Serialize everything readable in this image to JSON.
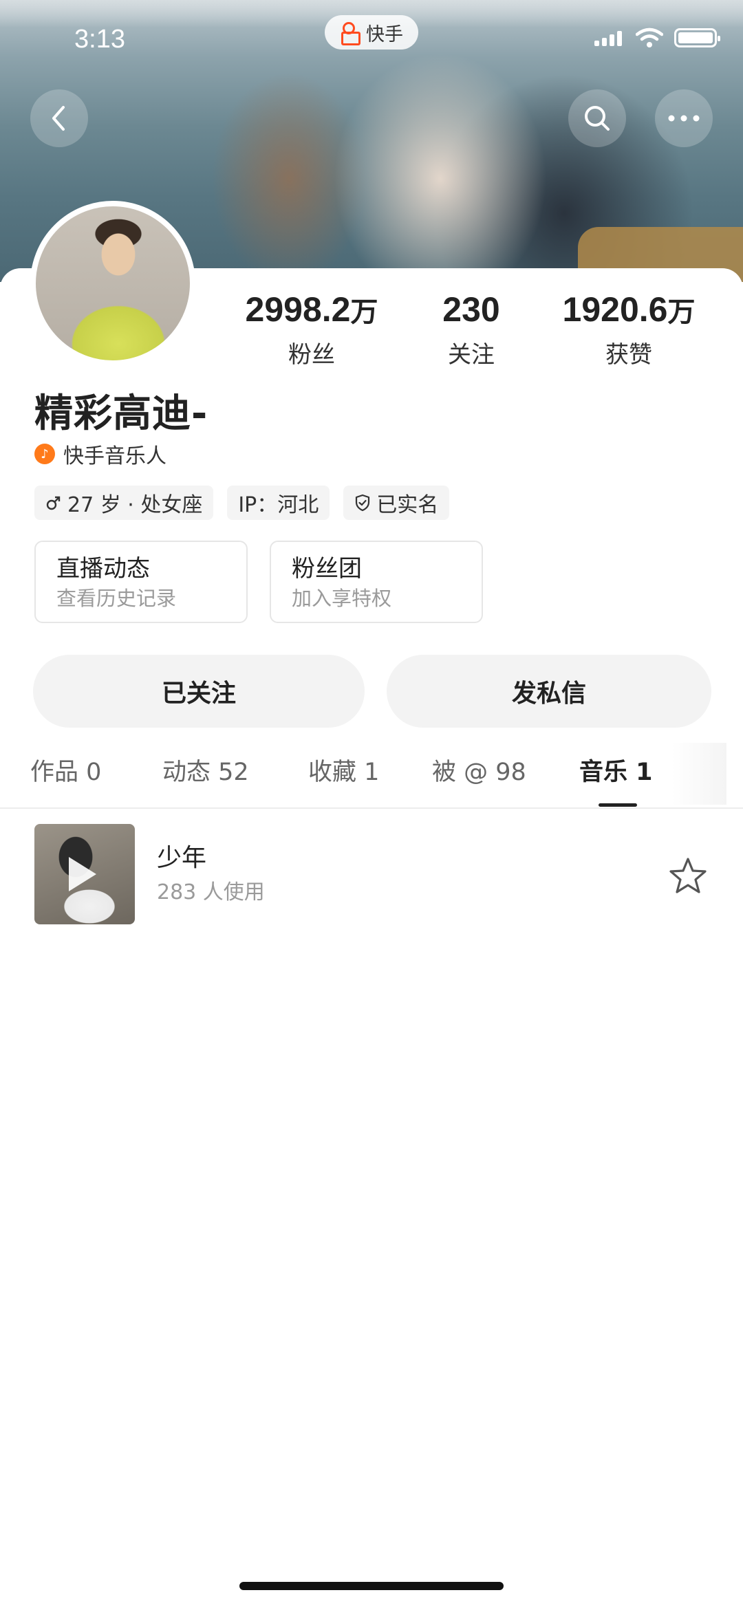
{
  "status_bar": {
    "time": "3:13",
    "app_name": "快手"
  },
  "header": {
    "back_icon": "chevron-left-icon",
    "search_icon": "search-icon",
    "more_icon": "more-dots-icon"
  },
  "profile": {
    "username": "精彩高迪-",
    "badge": "快手音乐人",
    "stats": [
      {
        "value": "2998.2",
        "unit": "万",
        "label": "粉丝"
      },
      {
        "value": "230",
        "unit": "",
        "label": "关注"
      },
      {
        "value": "1920.6",
        "unit": "万",
        "label": "获赞"
      }
    ],
    "tags": {
      "age": "27 岁 · 处女座",
      "ip": "IP：河北",
      "verified": "已实名"
    }
  },
  "features": [
    {
      "title": "直播动态",
      "subtitle": "查看历史记录"
    },
    {
      "title": "粉丝团",
      "subtitle": "加入享特权"
    }
  ],
  "actions": {
    "follow_label": "已关注",
    "message_label": "发私信"
  },
  "tabs": [
    {
      "label": "作品 0"
    },
    {
      "label": "动态 52"
    },
    {
      "label": "收藏 1"
    },
    {
      "label": "被 @ 98"
    },
    {
      "label": "音乐 1",
      "active": true
    }
  ],
  "music_list": [
    {
      "title": "少年",
      "usage": "283 人使用"
    }
  ],
  "colors": {
    "brand": "#ff4b1f",
    "musician_badge": "#ff7a1a",
    "button_bg": "#f3f3f3"
  }
}
